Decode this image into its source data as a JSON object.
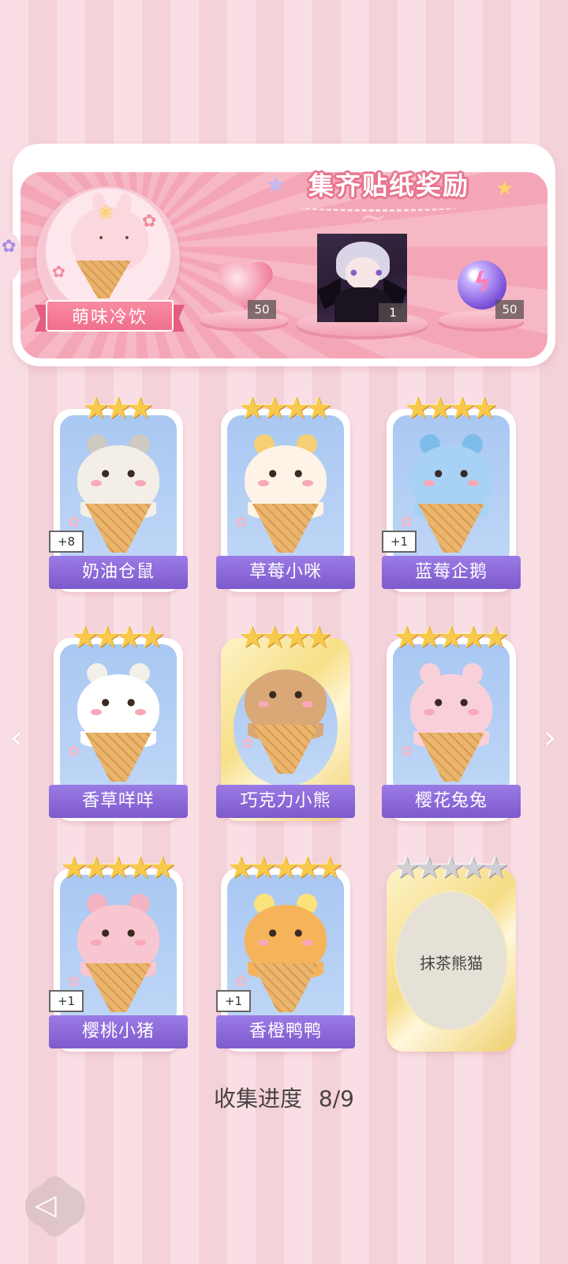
{
  "banner": {
    "title": "集齐贴纸奖励",
    "set_name": "萌味冷饮",
    "rewards": [
      {
        "name": "heart-gem",
        "count": "50"
      },
      {
        "name": "character-portrait",
        "count": "1"
      },
      {
        "name": "energy-orb",
        "count": "50"
      }
    ]
  },
  "cards": [
    {
      "name": "奶油仓鼠",
      "stars": 3,
      "badge": "+8",
      "scoop": "#f4efe6",
      "accent": "#cfcac1"
    },
    {
      "name": "草莓小咪",
      "stars": 4,
      "badge": "",
      "scoop": "#fdf3e6",
      "accent": "#f7cf76"
    },
    {
      "name": "蓝莓企鹅",
      "stars": 4,
      "badge": "+1",
      "scoop": "#a8d2f5",
      "accent": "#7ebde9"
    },
    {
      "name": "香草咩咩",
      "stars": 4,
      "badge": "",
      "scoop": "#ffffff",
      "accent": "#f3f0ea"
    },
    {
      "name": "巧克力小熊",
      "stars": 4,
      "badge": "",
      "scoop": "#d9a876",
      "accent": "#c48e5a"
    },
    {
      "name": "樱花兔兔",
      "stars": 5,
      "badge": "",
      "scoop": "#f9d0da",
      "accent": "#f9d0da"
    },
    {
      "name": "樱桃小猪",
      "stars": 5,
      "badge": "+1",
      "scoop": "#f8c6d0",
      "accent": "#f4b3c2"
    },
    {
      "name": "香橙鸭鸭",
      "stars": 5,
      "badge": "+1",
      "scoop": "#f5b45a",
      "accent": "#fbe27a"
    }
  ],
  "locked_card": {
    "name": "抹茶熊猫",
    "stars": 5
  },
  "progress": {
    "label": "收集进度",
    "value": "8/9"
  }
}
